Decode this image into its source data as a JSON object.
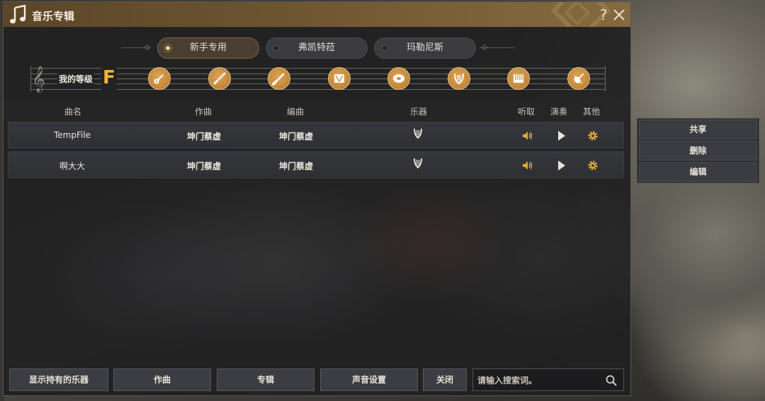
{
  "window": {
    "title": "音乐专辑",
    "help_label": "?"
  },
  "tabs": [
    {
      "label": "新手专用",
      "active": true
    },
    {
      "label": "弗凯特菈",
      "active": false
    },
    {
      "label": "玛勒尼斯",
      "active": false
    }
  ],
  "level": {
    "label": "我的等级",
    "grade": "F",
    "instruments": [
      "guitar-icon",
      "flute-icon",
      "clarinet-icon",
      "drum-icon",
      "cymbal-icon",
      "harp-icon",
      "piano-icon",
      "violin-icon"
    ]
  },
  "table": {
    "headers": {
      "name": "曲名",
      "composer": "作曲",
      "arranger": "编曲",
      "instrument": "乐器",
      "listen": "听取",
      "play": "演奏",
      "other": "其他"
    },
    "rows": [
      {
        "name": "TempFile",
        "composer": "坤门蔡虚",
        "arranger": "坤门蔡虚",
        "instrument": "harp-icon"
      },
      {
        "name": "啊大大",
        "composer": "坤门蔡虚",
        "arranger": "坤门蔡虚",
        "instrument": "harp-icon"
      }
    ]
  },
  "context_menu": {
    "items": [
      "共享",
      "删除",
      "编辑"
    ]
  },
  "bottom": {
    "show_instruments": "显示持有的乐器",
    "compose": "作曲",
    "album": "专辑",
    "sound_settings": "声音设置",
    "close": "关闭",
    "search_placeholder": "请输入搜索词。"
  },
  "colors": {
    "accent_gold": "#f0b43a",
    "title_bar": "#6b5330",
    "instrument_badge": "#c68a3c"
  }
}
